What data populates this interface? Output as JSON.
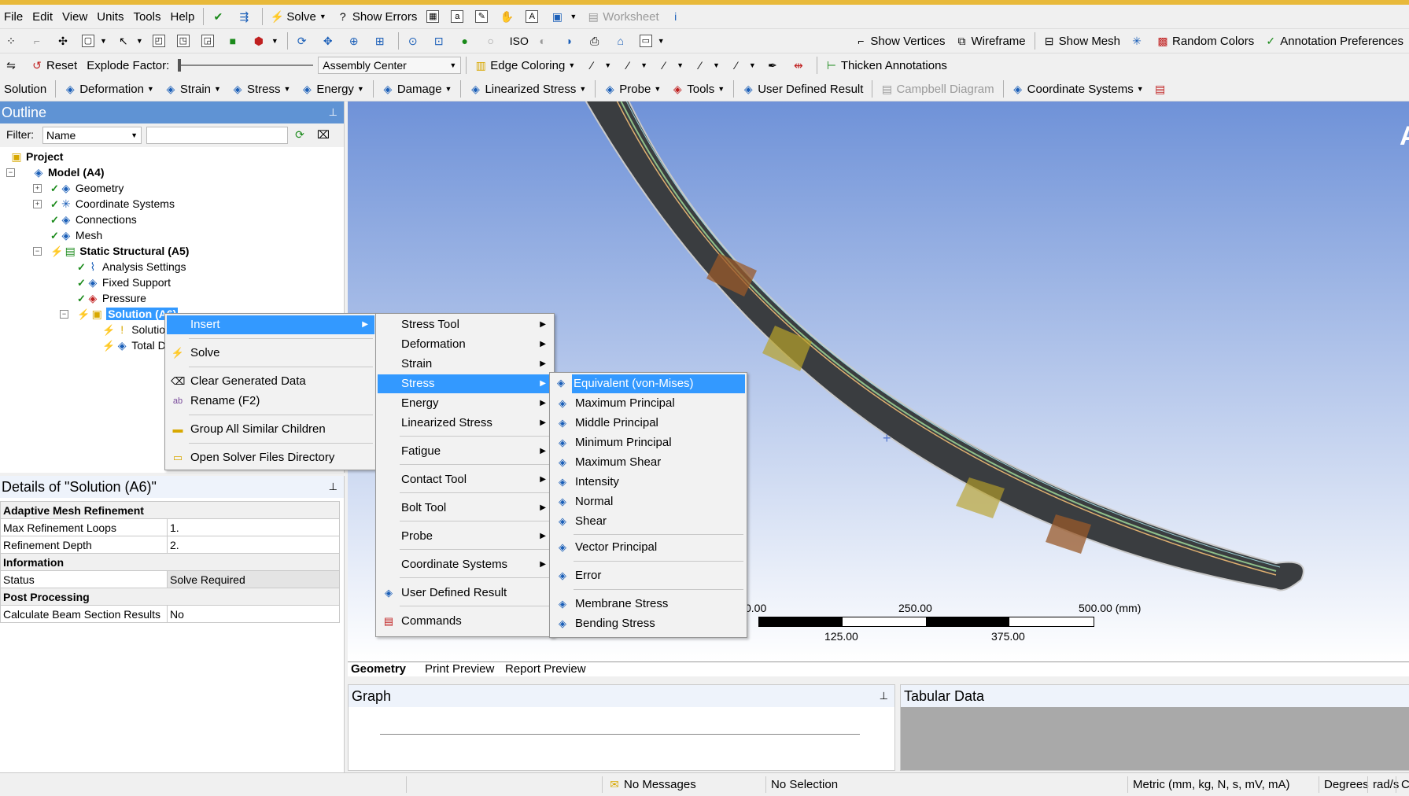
{
  "menubar": {
    "items": [
      "File",
      "Edit",
      "View",
      "Units",
      "Tools",
      "Help"
    ],
    "solve": "Solve",
    "show_errors": "Show Errors",
    "worksheet": "Worksheet"
  },
  "toolbar2": {
    "show_vertices": "Show Vertices",
    "wireframe": "Wireframe",
    "show_mesh": "Show Mesh",
    "random_colors": "Random Colors",
    "annotation_prefs": "Annotation Preferences"
  },
  "toolbar3": {
    "reset": "Reset",
    "explode_factor": "Explode Factor:",
    "assembly_center": "Assembly Center",
    "edge_coloring": "Edge Coloring",
    "thicken": "Thicken Annotations"
  },
  "toolbar4": {
    "items": [
      "Solution",
      "Deformation",
      "Strain",
      "Stress",
      "Energy",
      "Damage",
      "Linearized Stress",
      "Probe",
      "Tools",
      "User Defined Result",
      "Campbell Diagram",
      "Coordinate Systems"
    ]
  },
  "outline": {
    "title": "Outline",
    "filter_label": "Filter:",
    "filter_value": "Name",
    "tree": [
      "Project",
      "Model (A4)",
      "Geometry",
      "Coordinate Systems",
      "Connections",
      "Mesh",
      "Static Structural (A5)",
      "Analysis Settings",
      "Fixed Support",
      "Pressure",
      "Solution (A6)",
      "Solution Information",
      "Total Deformation"
    ]
  },
  "details": {
    "title": "Details of \"Solution (A6)\"",
    "groups": [
      {
        "name": "Adaptive Mesh Refinement",
        "rows": [
          [
            "Max Refinement Loops",
            "1."
          ],
          [
            "Refinement Depth",
            "2."
          ]
        ]
      },
      {
        "name": "Information",
        "rows": [
          [
            "Status",
            "Solve Required"
          ]
        ]
      },
      {
        "name": "Post Processing",
        "rows": [
          [
            "Calculate Beam Section Results",
            "No"
          ]
        ]
      }
    ]
  },
  "context_menu": {
    "items": [
      "Insert",
      "Solve",
      "Clear Generated Data",
      "Rename (F2)",
      "Group All Similar Children",
      "Open Solver Files Directory"
    ]
  },
  "insert_menu": {
    "items": [
      "Stress Tool",
      "Deformation",
      "Strain",
      "Stress",
      "Energy",
      "Linearized Stress",
      "Fatigue",
      "Contact Tool",
      "Bolt Tool",
      "Probe",
      "Coordinate Systems",
      "User Defined Result",
      "Commands"
    ]
  },
  "stress_menu": {
    "items": [
      "Equivalent (von-Mises)",
      "Maximum Principal",
      "Middle Principal",
      "Minimum Principal",
      "Maximum Shear",
      "Intensity",
      "Normal",
      "Shear",
      "Vector Principal",
      "Error",
      "Membrane Stress",
      "Bending Stress"
    ]
  },
  "viewport": {
    "corner_letter": "A",
    "scale_labels": [
      "0.00",
      "250.00",
      "500.00 (mm)",
      "125.00",
      "375.00"
    ]
  },
  "view_tabs": [
    "Geometry",
    "Print Preview",
    "Report Preview"
  ],
  "graph": {
    "title": "Graph"
  },
  "tabular": {
    "title": "Tabular Data"
  },
  "statusbar": {
    "messages": "No Messages",
    "selection": "No Selection",
    "units": "Metric (mm, kg, N, s, mV, mA)",
    "degrees": "Degrees",
    "rads": "rad/s",
    "ce": "Ce"
  },
  "colors": {
    "accent": "#5f93d4",
    "highlight": "#3399ff",
    "viewport_top": "#6f92d8",
    "viewport_bottom": "#ffffff"
  }
}
